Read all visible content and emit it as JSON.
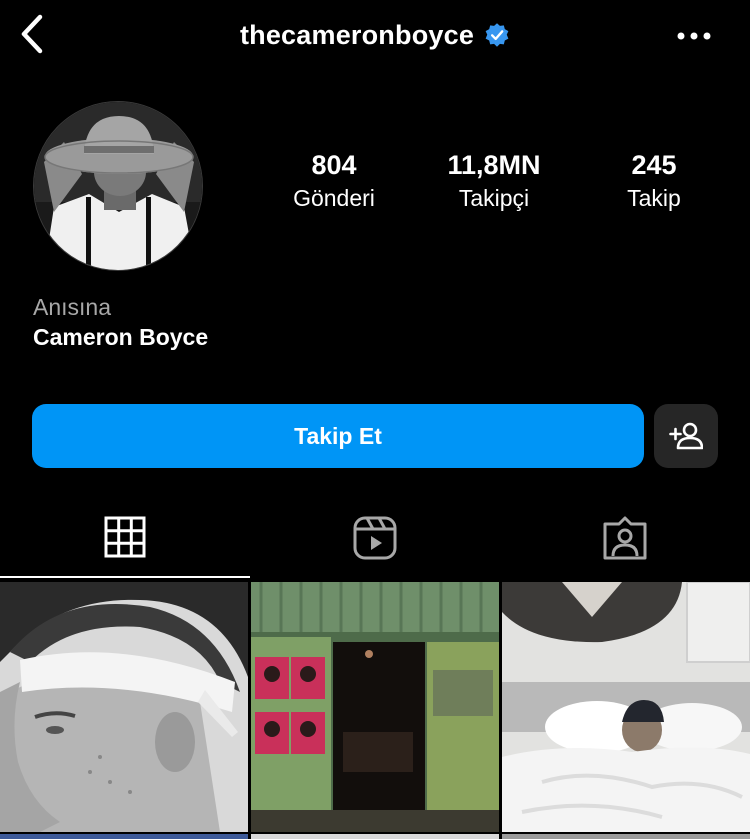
{
  "header": {
    "username": "thecameronboyce",
    "verified": true,
    "back_icon": "chevron-left-icon",
    "more_icon": "more-horizontal-icon"
  },
  "profile": {
    "stats": {
      "posts": {
        "value": "804",
        "label": "Gönderi"
      },
      "followers": {
        "value": "11,8MN",
        "label": "Takipçi"
      },
      "following": {
        "value": "245",
        "label": "Takip"
      }
    },
    "memorial_label": "Anısına",
    "full_name": "Cameron Boyce"
  },
  "actions": {
    "follow_label": "Takip Et",
    "suggest_icon": "add-person-icon"
  },
  "tabs": [
    {
      "name": "grid",
      "icon": "grid-icon",
      "active": true
    },
    {
      "name": "reels",
      "icon": "reels-icon",
      "active": false
    },
    {
      "name": "tagged",
      "icon": "tagged-person-icon",
      "active": false
    }
  ],
  "colors": {
    "background": "#000000",
    "accent": "#0095f6",
    "verified": "#3897f0",
    "secondary_button": "#262626",
    "muted_text": "#a8a8a8"
  }
}
